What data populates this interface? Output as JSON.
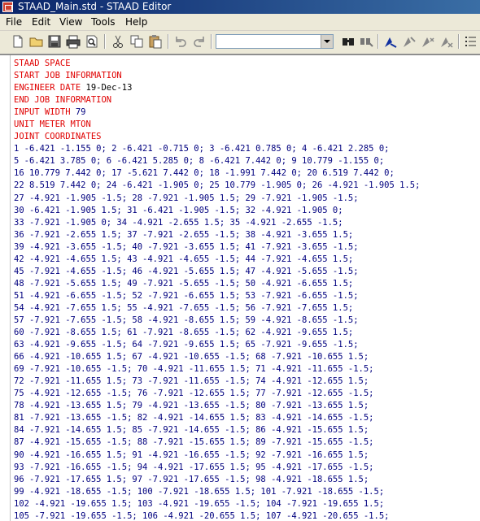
{
  "window": {
    "title": "STAAD_Main.std - STAAD Editor"
  },
  "menu": [
    "File",
    "Edit",
    "View",
    "Tools",
    "Help"
  ],
  "toolbar": {
    "combo_value": "",
    "icons": [
      "new-file-icon",
      "open-folder-icon",
      "save-icon",
      "print-icon",
      "print-preview-icon",
      "cut-icon",
      "copy-icon",
      "paste-icon",
      "undo-icon",
      "redo-icon",
      "find-icon",
      "find-next-icon",
      "run-analysis-icon",
      "view-icon",
      "tool-icon",
      "tool2-icon",
      "list-icon"
    ]
  },
  "editor": {
    "lines": [
      {
        "kw": "STAAD SPACE",
        "val": "",
        "num": ""
      },
      {
        "kw": "START JOB INFORMATION",
        "val": "",
        "num": ""
      },
      {
        "kw": "ENGINEER DATE ",
        "val": "19-Dec-13",
        "num": ""
      },
      {
        "kw": "END JOB INFORMATION",
        "val": "",
        "num": ""
      },
      {
        "kw": "INPUT WIDTH ",
        "val": "",
        "num": "79"
      },
      {
        "kw": "UNIT METER MTON",
        "val": "",
        "num": ""
      },
      {
        "kw": "JOINT COORDINATES",
        "val": "",
        "num": ""
      },
      {
        "kw": "",
        "val": "",
        "num": "1 -6.421 -1.155 0; 2 -6.421 -0.715 0; 3 -6.421 0.785 0; 4 -6.421 2.285 0;"
      },
      {
        "kw": "",
        "val": "",
        "num": "5 -6.421 3.785 0; 6 -6.421 5.285 0; 8 -6.421 7.442 0; 9 10.779 -1.155 0;"
      },
      {
        "kw": "",
        "val": "",
        "num": "16 10.779 7.442 0; 17 -5.621 7.442 0; 18 -1.991 7.442 0; 20 6.519 7.442 0;"
      },
      {
        "kw": "",
        "val": "",
        "num": "22 8.519 7.442 0; 24 -6.421 -1.905 0; 25 10.779 -1.905 0; 26 -4.921 -1.905 1.5;"
      },
      {
        "kw": "",
        "val": "",
        "num": "27 -4.921 -1.905 -1.5; 28 -7.921 -1.905 1.5; 29 -7.921 -1.905 -1.5;"
      },
      {
        "kw": "",
        "val": "",
        "num": "30 -6.421 -1.905 1.5; 31 -6.421 -1.905 -1.5; 32 -4.921 -1.905 0;"
      },
      {
        "kw": "",
        "val": "",
        "num": "33 -7.921 -1.905 0; 34 -4.921 -2.655 1.5; 35 -4.921 -2.655 -1.5;"
      },
      {
        "kw": "",
        "val": "",
        "num": "36 -7.921 -2.655 1.5; 37 -7.921 -2.655 -1.5; 38 -4.921 -3.655 1.5;"
      },
      {
        "kw": "",
        "val": "",
        "num": "39 -4.921 -3.655 -1.5; 40 -7.921 -3.655 1.5; 41 -7.921 -3.655 -1.5;"
      },
      {
        "kw": "",
        "val": "",
        "num": "42 -4.921 -4.655 1.5; 43 -4.921 -4.655 -1.5; 44 -7.921 -4.655 1.5;"
      },
      {
        "kw": "",
        "val": "",
        "num": "45 -7.921 -4.655 -1.5; 46 -4.921 -5.655 1.5; 47 -4.921 -5.655 -1.5;"
      },
      {
        "kw": "",
        "val": "",
        "num": "48 -7.921 -5.655 1.5; 49 -7.921 -5.655 -1.5; 50 -4.921 -6.655 1.5;"
      },
      {
        "kw": "",
        "val": "",
        "num": "51 -4.921 -6.655 -1.5; 52 -7.921 -6.655 1.5; 53 -7.921 -6.655 -1.5;"
      },
      {
        "kw": "",
        "val": "",
        "num": "54 -4.921 -7.655 1.5; 55 -4.921 -7.655 -1.5; 56 -7.921 -7.655 1.5;"
      },
      {
        "kw": "",
        "val": "",
        "num": "57 -7.921 -7.655 -1.5; 58 -4.921 -8.655 1.5; 59 -4.921 -8.655 -1.5;"
      },
      {
        "kw": "",
        "val": "",
        "num": "60 -7.921 -8.655 1.5; 61 -7.921 -8.655 -1.5; 62 -4.921 -9.655 1.5;"
      },
      {
        "kw": "",
        "val": "",
        "num": "63 -4.921 -9.655 -1.5; 64 -7.921 -9.655 1.5; 65 -7.921 -9.655 -1.5;"
      },
      {
        "kw": "",
        "val": "",
        "num": "66 -4.921 -10.655 1.5; 67 -4.921 -10.655 -1.5; 68 -7.921 -10.655 1.5;"
      },
      {
        "kw": "",
        "val": "",
        "num": "69 -7.921 -10.655 -1.5; 70 -4.921 -11.655 1.5; 71 -4.921 -11.655 -1.5;"
      },
      {
        "kw": "",
        "val": "",
        "num": "72 -7.921 -11.655 1.5; 73 -7.921 -11.655 -1.5; 74 -4.921 -12.655 1.5;"
      },
      {
        "kw": "",
        "val": "",
        "num": "75 -4.921 -12.655 -1.5; 76 -7.921 -12.655 1.5; 77 -7.921 -12.655 -1.5;"
      },
      {
        "kw": "",
        "val": "",
        "num": "78 -4.921 -13.655 1.5; 79 -4.921 -13.655 -1.5; 80 -7.921 -13.655 1.5;"
      },
      {
        "kw": "",
        "val": "",
        "num": "81 -7.921 -13.655 -1.5; 82 -4.921 -14.655 1.5; 83 -4.921 -14.655 -1.5;"
      },
      {
        "kw": "",
        "val": "",
        "num": "84 -7.921 -14.655 1.5; 85 -7.921 -14.655 -1.5; 86 -4.921 -15.655 1.5;"
      },
      {
        "kw": "",
        "val": "",
        "num": "87 -4.921 -15.655 -1.5; 88 -7.921 -15.655 1.5; 89 -7.921 -15.655 -1.5;"
      },
      {
        "kw": "",
        "val": "",
        "num": "90 -4.921 -16.655 1.5; 91 -4.921 -16.655 -1.5; 92 -7.921 -16.655 1.5;"
      },
      {
        "kw": "",
        "val": "",
        "num": "93 -7.921 -16.655 -1.5; 94 -4.921 -17.655 1.5; 95 -4.921 -17.655 -1.5;"
      },
      {
        "kw": "",
        "val": "",
        "num": "96 -7.921 -17.655 1.5; 97 -7.921 -17.655 -1.5; 98 -4.921 -18.655 1.5;"
      },
      {
        "kw": "",
        "val": "",
        "num": "99 -4.921 -18.655 -1.5; 100 -7.921 -18.655 1.5; 101 -7.921 -18.655 -1.5;"
      },
      {
        "kw": "",
        "val": "",
        "num": "102 -4.921 -19.655 1.5; 103 -4.921 -19.655 -1.5; 104 -7.921 -19.655 1.5;"
      },
      {
        "kw": "",
        "val": "",
        "num": "105 -7.921 -19.655 -1.5; 106 -4.921 -20.655 1.5; 107 -4.921 -20.655 -1.5;"
      }
    ]
  },
  "colors": {
    "keyword": "#e00000",
    "number": "#00007f",
    "text": "#000000",
    "titlebar": "#0a246a"
  }
}
